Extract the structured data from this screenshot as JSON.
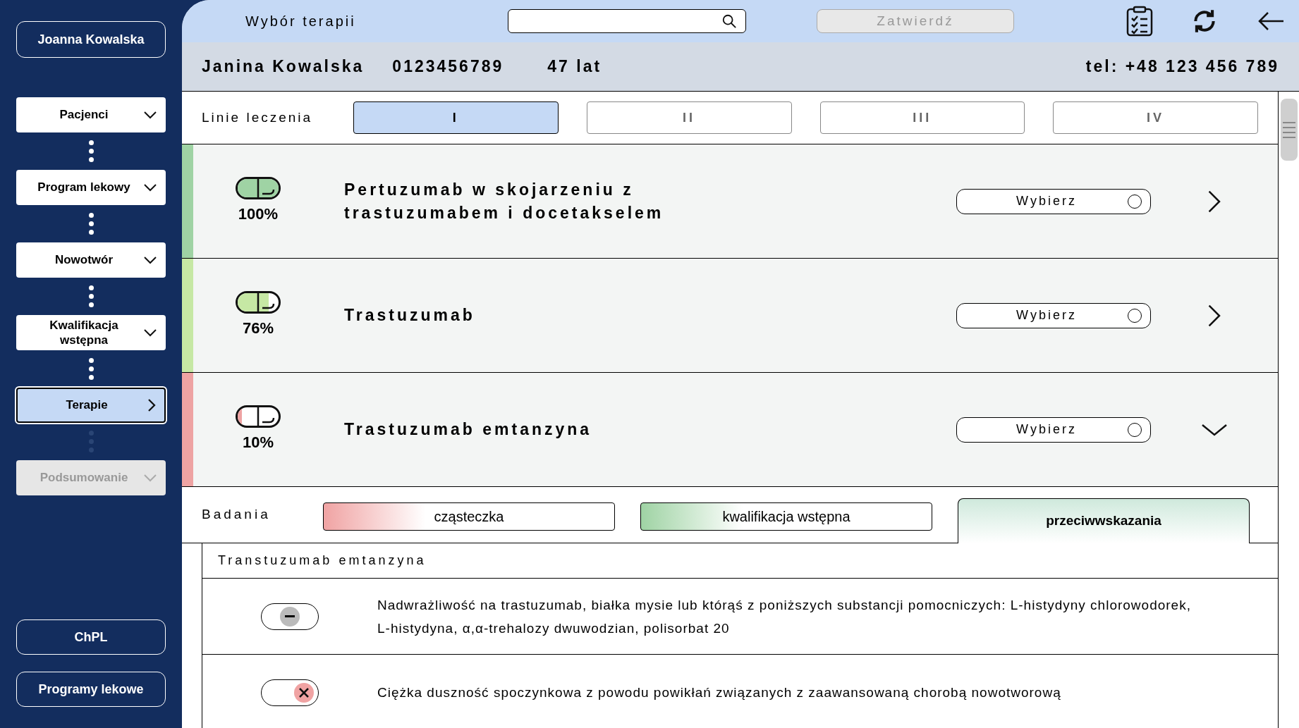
{
  "sidebar": {
    "user": "Joanna Kowalska",
    "steps": [
      {
        "label": "Pacjenci",
        "selected": false,
        "disabled": false
      },
      {
        "label": "Program lekowy",
        "selected": false,
        "disabled": false
      },
      {
        "label": "Nowotwór",
        "selected": false,
        "disabled": false
      },
      {
        "label": "Kwalifikacja wstępna",
        "selected": false,
        "disabled": false
      },
      {
        "label": "Terapie",
        "selected": true,
        "disabled": false
      },
      {
        "label": "Podsumowanie",
        "selected": false,
        "disabled": true
      }
    ],
    "bottom_buttons": [
      "ChPL",
      "Programy lekowe"
    ]
  },
  "top_bar": {
    "title": "Wybór terapii",
    "confirm": {
      "label": "Zatwierdź",
      "disabled": true
    }
  },
  "patient": {
    "name": "Janina Kowalska",
    "id": "0123456789",
    "age": "47 lat",
    "phone": "tel: +48 123 456 789"
  },
  "treatment_lines": {
    "label": "Linie leczenia",
    "tabs": [
      {
        "label": "I",
        "selected": true
      },
      {
        "label": "II",
        "selected": false
      },
      {
        "label": "III",
        "selected": false
      },
      {
        "label": "IV",
        "selected": false
      }
    ]
  },
  "therapies": [
    {
      "name": "Pertuzumab w skojarzeniu z trastuzumabem i docetakselem",
      "percent": "100%",
      "level": 1,
      "color": "#9fd3a4",
      "button": "Wybierz",
      "selected": false,
      "expanded": false
    },
    {
      "name": "Trastuzumab",
      "percent": "76%",
      "level": 0.76,
      "color": "#c6e8a4",
      "button": "Wybierz",
      "selected": false,
      "expanded": false
    },
    {
      "name": "Trastuzumab emtanzyna",
      "percent": "10%",
      "level": 0.1,
      "color": "#eea3a3",
      "button": "Wybierz",
      "selected": false,
      "expanded": true
    }
  ],
  "details": {
    "label": "Badania",
    "tabs": [
      {
        "label": "cząsteczka",
        "selected": false,
        "color": "#f0a3a3"
      },
      {
        "label": "kwalifikacja wstępna",
        "selected": false,
        "color": "#9fd3a4"
      },
      {
        "label": "przeciwwskazania",
        "selected": true,
        "color": "#cfe9dc"
      }
    ],
    "table_title": "Transtuzumab emtanzyna",
    "rows": [
      {
        "kind": "neutral",
        "text": "Nadwrażliwość na trastuzumab, białka mysie lub którąś z poniższych substancji pomocniczych: L-histydyny chlorowodorek, L-histydyna, α,α-trehalozy dwuwodzian, polisorbat 20"
      },
      {
        "kind": "negative",
        "text": "Ciężka duszność spoczynkowa z powodu powikłań związanych z zaawansowaną chorobą nowotworową"
      }
    ]
  }
}
